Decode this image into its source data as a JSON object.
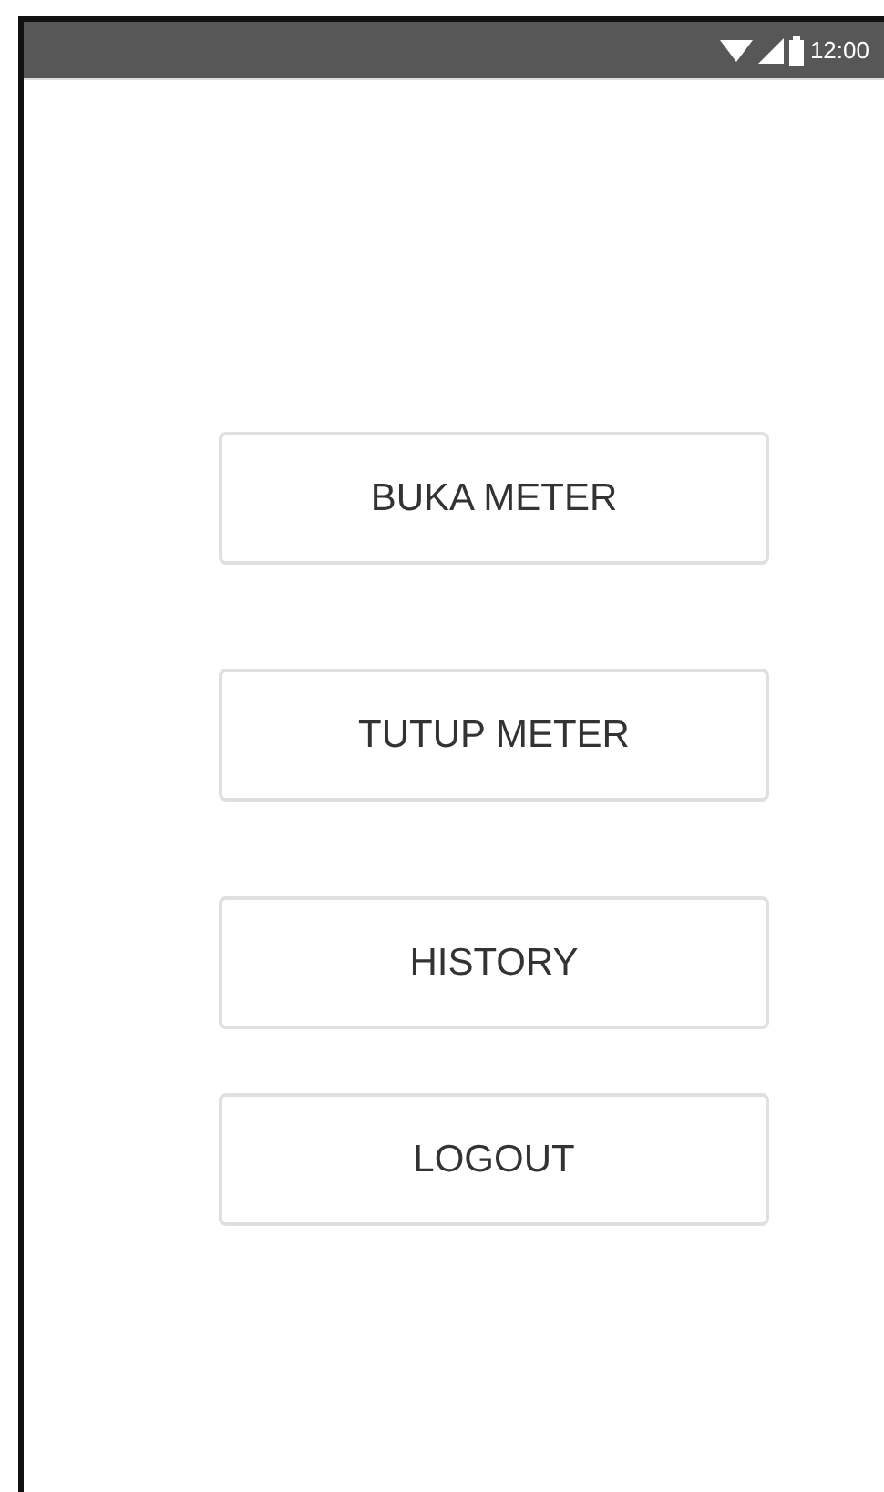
{
  "status_bar": {
    "time": "12:00"
  },
  "buttons": [
    {
      "label": "BUKA METER"
    },
    {
      "label": "TUTUP METER"
    },
    {
      "label": "HISTORY"
    },
    {
      "label": "LOGOUT"
    }
  ]
}
